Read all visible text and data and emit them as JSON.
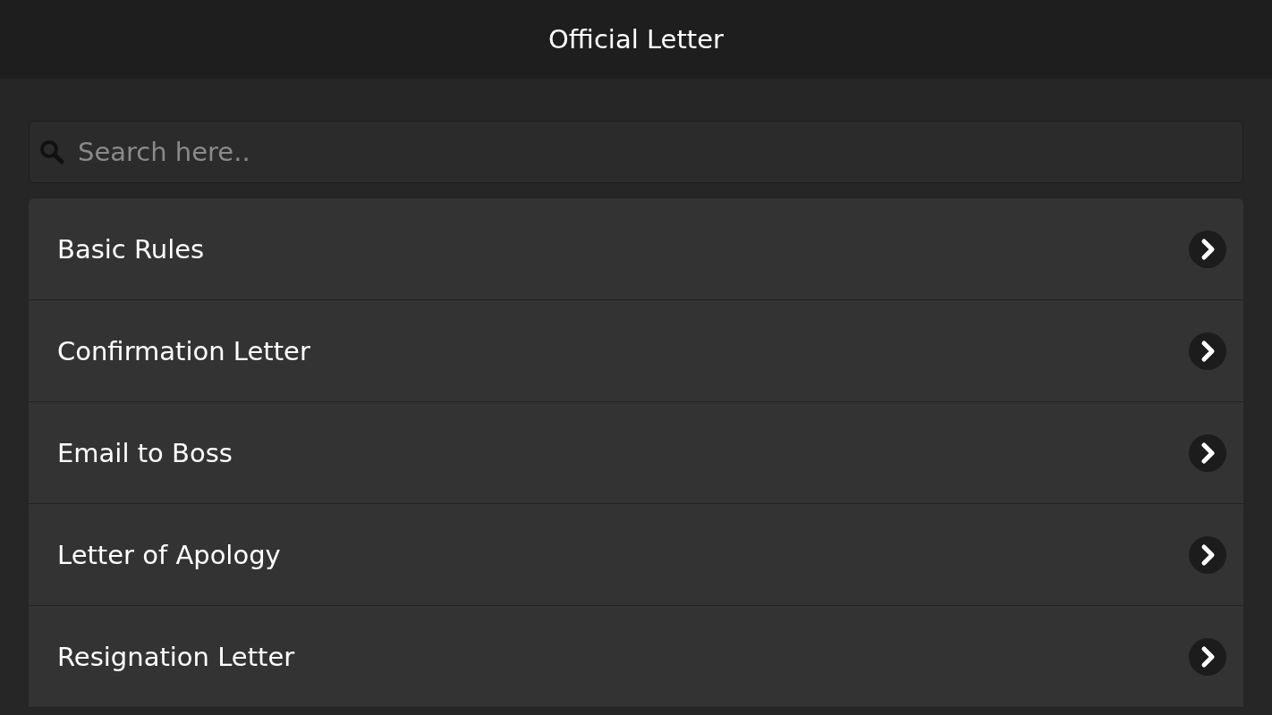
{
  "header": {
    "title": "Official Letter"
  },
  "search": {
    "placeholder": "Search here.."
  },
  "items": [
    {
      "label": "Basic Rules"
    },
    {
      "label": "Confirmation Letter"
    },
    {
      "label": "Email to Boss"
    },
    {
      "label": "Letter of Apology"
    },
    {
      "label": "Resignation Letter"
    }
  ]
}
